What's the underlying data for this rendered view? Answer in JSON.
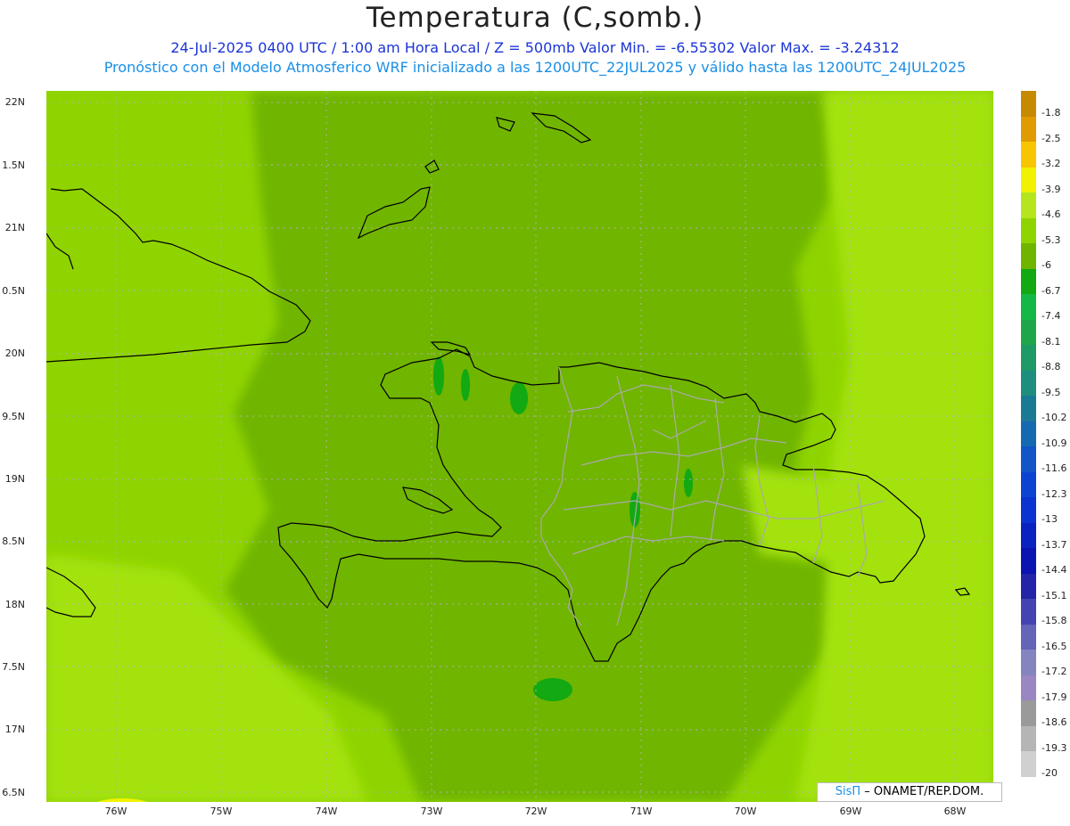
{
  "header": {
    "title": "Temperatura (C,somb.)",
    "line1": "24-Jul-2025   0400 UTC / 1:00 am Hora Local / Z = 500mb  Valor Min. = -6.55302  Valor Max. = -3.24312",
    "line2": "Pronóstico con el Modelo Atmosferico WRF inicializado a las 1200UTC_22JUL2025 y válido hasta las  1200UTC_24JUL2025"
  },
  "axes": {
    "lat_labels": [
      "22N",
      "1.5N",
      "21N",
      "0.5N",
      "20N",
      "9.5N",
      "19N",
      "8.5N",
      "18N",
      "7.5N",
      "17N",
      "6.5N"
    ],
    "lon_labels": [
      "76W",
      "75W",
      "74W",
      "73W",
      "72W",
      "71W",
      "70W",
      "69W",
      "68W"
    ]
  },
  "colorbar": {
    "labels": [
      "-1.8",
      "-2.5",
      "-3.2",
      "-3.9",
      "-4.6",
      "-5.3",
      "-6",
      "-6.7",
      "-7.4",
      "-8.1",
      "-8.8",
      "-9.5",
      "-10.2",
      "-10.9",
      "-11.6",
      "-12.3",
      "-13",
      "-13.7",
      "-14.4",
      "-15.1",
      "-15.8",
      "-16.5",
      "-17.2",
      "-17.9",
      "-18.6",
      "-19.3",
      "-20"
    ],
    "colors": [
      "#c68a00",
      "#e09b00",
      "#f7c600",
      "#f2f200",
      "#b5e61d",
      "#8fd400",
      "#6fb500",
      "#12a912",
      "#16b845",
      "#1fa64a",
      "#1d9a66",
      "#1f8e7e",
      "#1a7a96",
      "#1569b0",
      "#1155c6",
      "#0c44d1",
      "#0a33cf",
      "#0a22bf",
      "#0b13b0",
      "#2424a8",
      "#4444b0",
      "#6464b8",
      "#8484c0",
      "#9a86c0",
      "#9a9a9a",
      "#b5b5b5",
      "#d0d0d0",
      "#ffffff"
    ]
  },
  "credit": {
    "brand": "SisΠ",
    "org": "– ONAMET/REP.DOM."
  }
}
